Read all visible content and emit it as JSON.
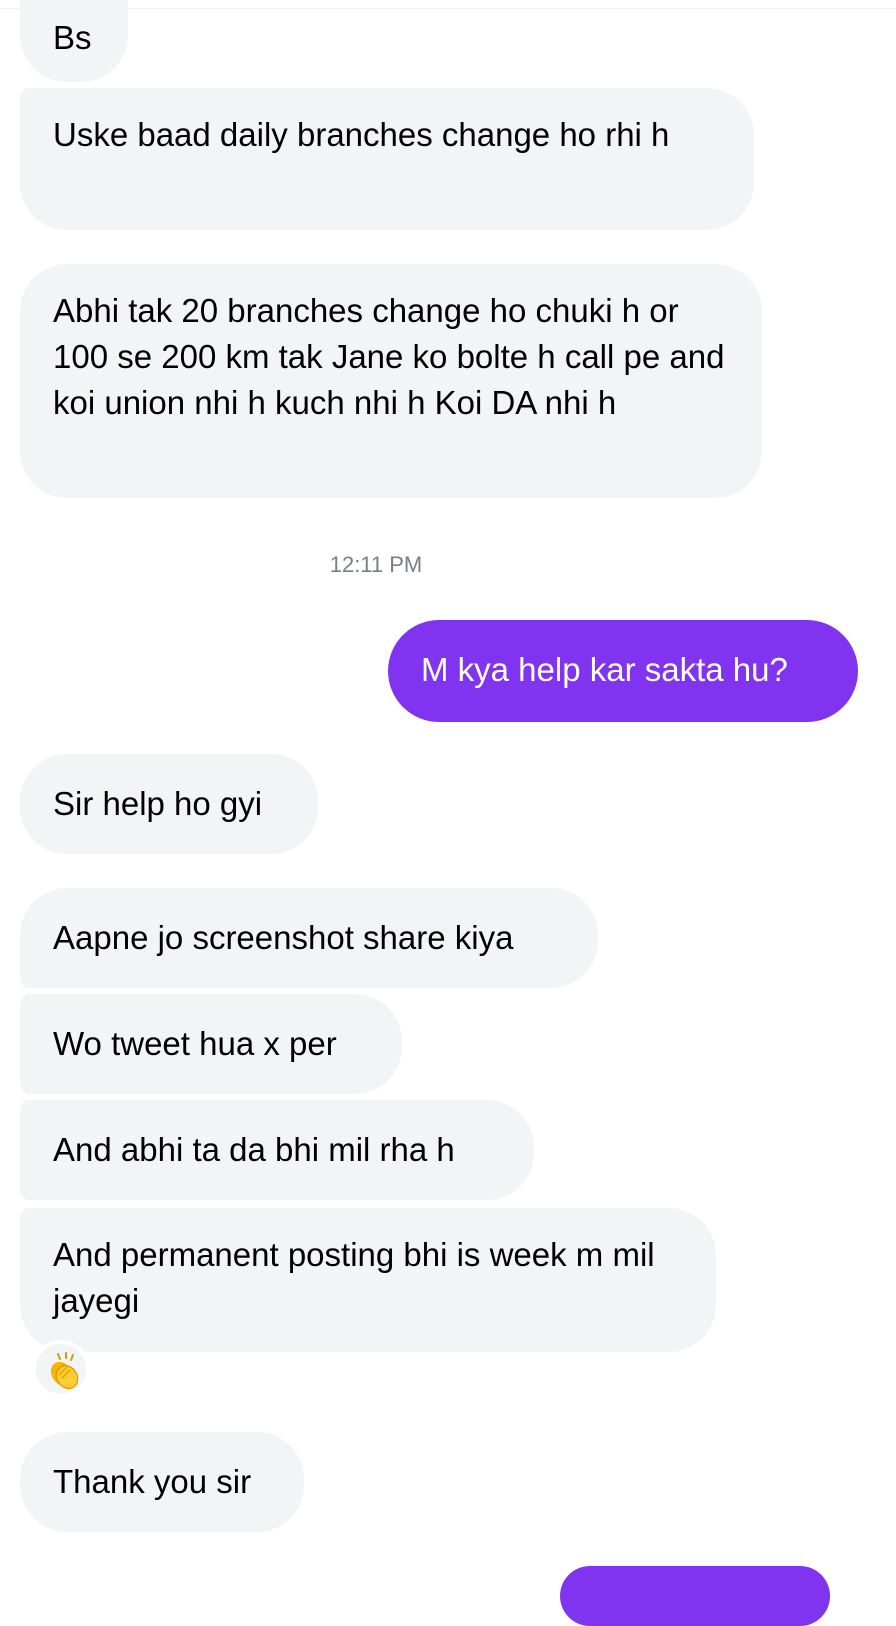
{
  "thread": {
    "messages": [
      {
        "id": "m1",
        "text": "Bs"
      },
      {
        "id": "m2",
        "text": "Uske baad daily branches change ho rhi h"
      },
      {
        "id": "m3",
        "text": "Abhi tak 20 branches change ho chuki h or 100 se 200 km tak Jane ko bolte h call pe and koi union nhi h kuch nhi h Koi DA nhi h"
      },
      {
        "id": "m4",
        "text": "M kya help kar sakta hu?"
      },
      {
        "id": "m5",
        "text": "Sir help ho gyi"
      },
      {
        "id": "m6",
        "text": "Aapne jo screenshot share kiya"
      },
      {
        "id": "m7",
        "text": "Wo tweet hua x per"
      },
      {
        "id": "m8",
        "text": "And abhi ta da bhi mil rha h"
      },
      {
        "id": "m9",
        "text": "And permanent posting bhi is week m mil jayegi"
      },
      {
        "id": "m10",
        "text": "Thank you sir"
      }
    ],
    "timestamp": "12:11 PM",
    "reaction_icon": "clapping-hands-icon"
  },
  "colors": {
    "sent_bubble": "#8134f0",
    "received_bubble": "#f3f4f6",
    "timestamp_text": "#7a7f87"
  }
}
